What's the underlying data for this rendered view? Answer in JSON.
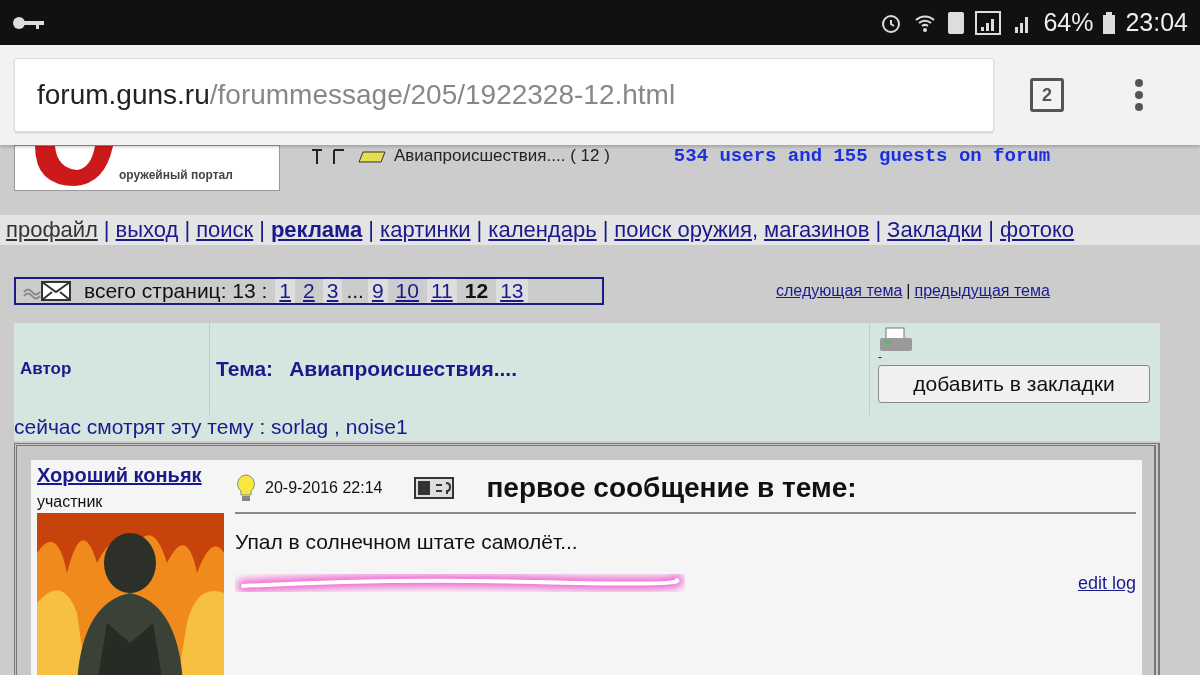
{
  "status_bar": {
    "battery": "64%",
    "time": "23:04"
  },
  "browser": {
    "url_host": "forum.guns.ru",
    "url_path": "/forummessage/205/1922328-12.html",
    "tab_count": "2"
  },
  "header": {
    "logo_tagline": "оружейный портал",
    "breadcrumb": "Авиапроисшествия.... ( 12 )",
    "online": "534 users and 155 guests on forum"
  },
  "nav": [
    {
      "label": "профайл",
      "bold": false,
      "visited": true,
      "separator": "|"
    },
    {
      "label": "выход",
      "bold": false,
      "visited": false,
      "separator": "|"
    },
    {
      "label": "поиск",
      "bold": false,
      "visited": false,
      "separator": "|"
    },
    {
      "label": "реклама",
      "bold": true,
      "visited": false,
      "separator": "|"
    },
    {
      "label": "картинки",
      "bold": false,
      "visited": false,
      "separator": "|"
    },
    {
      "label": "календарь",
      "bold": false,
      "visited": false,
      "separator": "|"
    },
    {
      "label": "поиск оружия",
      "bold": false,
      "visited": false,
      "separator": ","
    },
    {
      "label": "магазинов",
      "bold": false,
      "visited": false,
      "separator": "|"
    },
    {
      "label": "Закладки",
      "bold": false,
      "visited": false,
      "separator": "|"
    },
    {
      "label": "фотоко",
      "bold": false,
      "visited": false
    }
  ],
  "pagination": {
    "label": "всего страниц: 13 :",
    "pages": [
      {
        "label": "1",
        "selected": false,
        "shaded": true
      },
      {
        "label": "2",
        "selected": false,
        "shaded": false
      },
      {
        "label": "3",
        "selected": false,
        "shaded": true
      },
      {
        "label": "...",
        "kind": "gap"
      },
      {
        "label": "9",
        "selected": false,
        "shaded": true
      },
      {
        "label": "10",
        "selected": false,
        "shaded": false
      },
      {
        "label": "11",
        "selected": false,
        "shaded": true
      },
      {
        "label": "12",
        "selected": true,
        "shaded": false
      },
      {
        "label": "13",
        "selected": false,
        "shaded": true
      }
    ]
  },
  "topic_nav": {
    "next": "следующая тема",
    "separator": "|",
    "prev": "предыдущая тема"
  },
  "topic_header": {
    "author_label": "Автор",
    "topic_label": "Тема:",
    "topic_title": "Авиапроисшествия....",
    "print_dash": "-",
    "bookmark_button": "добавить в закладки",
    "viewers": "сейчас смотрят эту тему : sorlag , noise1"
  },
  "post": {
    "author": "Хороший коньяк",
    "rank": "участник",
    "date": "20-9-2016 22:14",
    "title": "первое сообщение в теме:",
    "body": "Упал в солнечном штате самолёт...",
    "edit_log": "edit log"
  }
}
